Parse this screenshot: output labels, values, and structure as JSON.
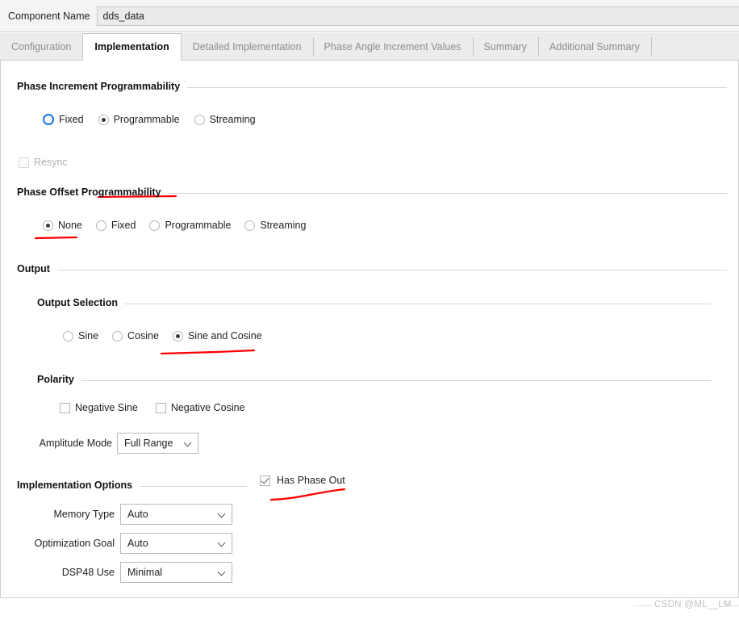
{
  "header": {
    "component_name_label": "Component Name",
    "component_name_value": "dds_data"
  },
  "tabs": [
    {
      "label": "Configuration",
      "active": false
    },
    {
      "label": "Implementation",
      "active": true
    },
    {
      "label": "Detailed Implementation",
      "active": false
    },
    {
      "label": "Phase Angle Increment Values",
      "active": false
    },
    {
      "label": "Summary",
      "active": false
    },
    {
      "label": "Additional Summary",
      "active": false
    }
  ],
  "sections": {
    "phase_increment": {
      "title": "Phase Increment Programmability",
      "options": [
        {
          "label": "Fixed",
          "checked": false,
          "focused": true
        },
        {
          "label": "Programmable",
          "checked": true,
          "focused": false
        },
        {
          "label": "Streaming",
          "checked": false,
          "focused": false
        }
      ],
      "resync": {
        "label": "Resync",
        "checked": false,
        "disabled": true
      }
    },
    "phase_offset": {
      "title": "Phase Offset Programmability",
      "options": [
        {
          "label": "None",
          "checked": true
        },
        {
          "label": "Fixed",
          "checked": false
        },
        {
          "label": "Programmable",
          "checked": false
        },
        {
          "label": "Streaming",
          "checked": false
        }
      ]
    },
    "output": {
      "title": "Output",
      "output_selection": {
        "title": "Output Selection",
        "options": [
          {
            "label": "Sine",
            "checked": false
          },
          {
            "label": "Cosine",
            "checked": false
          },
          {
            "label": "Sine and Cosine",
            "checked": true
          }
        ]
      },
      "polarity": {
        "title": "Polarity",
        "options": [
          {
            "label": "Negative Sine",
            "checked": false
          },
          {
            "label": "Negative Cosine",
            "checked": false
          }
        ]
      },
      "amplitude_mode": {
        "label": "Amplitude Mode",
        "value": "Full Range"
      }
    },
    "implementation_options": {
      "title": "Implementation Options",
      "fields": [
        {
          "label": "Memory Type",
          "value": "Auto"
        },
        {
          "label": "Optimization Goal",
          "value": "Auto"
        },
        {
          "label": "DSP48 Use",
          "value": "Minimal"
        }
      ]
    },
    "has_phase_out": {
      "label": "Has Phase Out",
      "checked": true
    }
  },
  "annotations": {
    "color": "#ff0000",
    "marks": [
      "underline-programmable",
      "underline-none",
      "underline-sine-and-cosine",
      "underline-has-phase-out"
    ]
  },
  "watermark": {
    "text": "CSDN @ML__LM"
  }
}
